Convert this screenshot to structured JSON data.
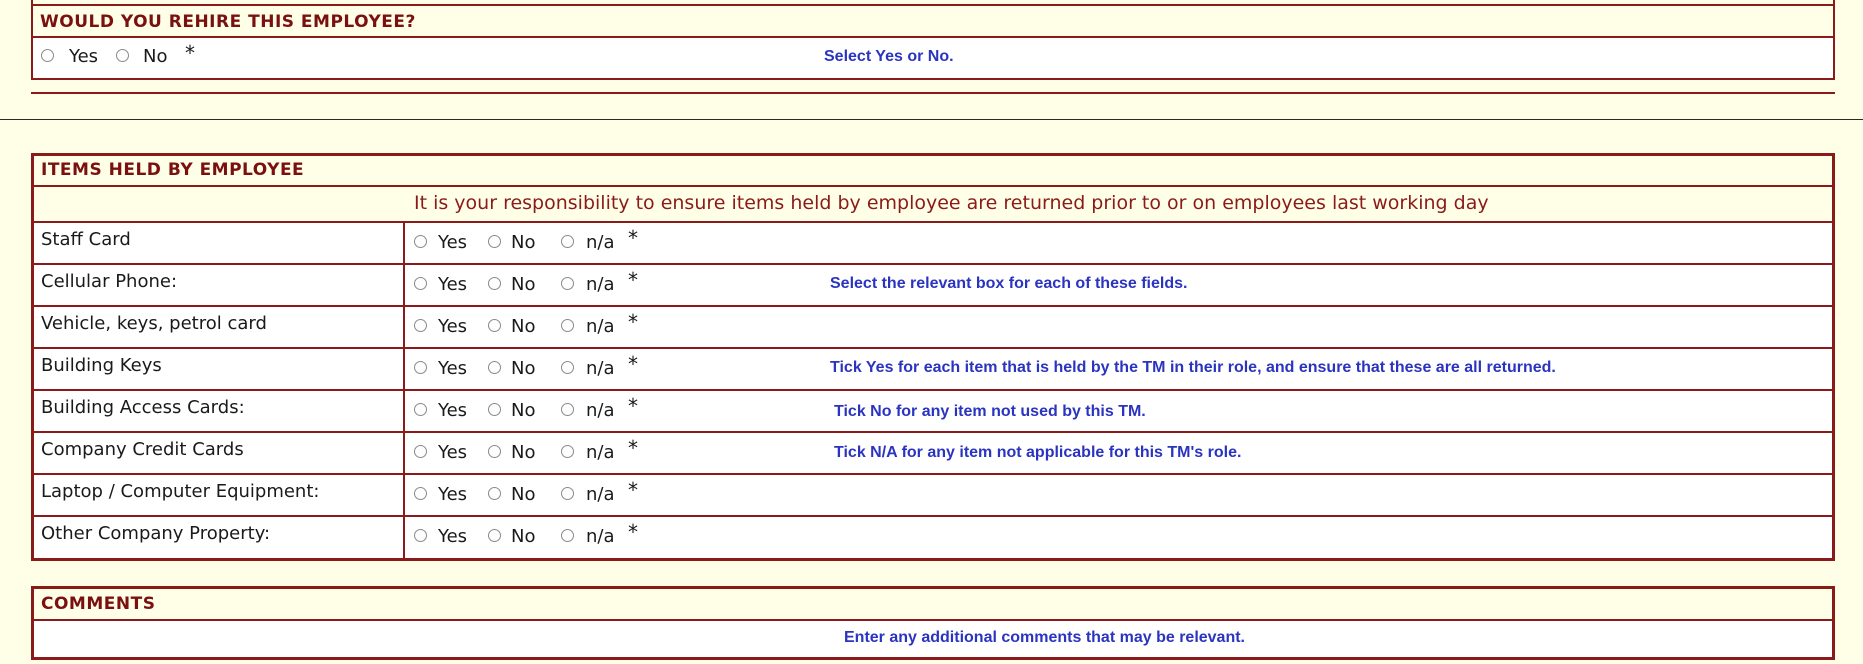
{
  "rehire": {
    "heading": "WOULD YOU REHIRE THIS EMPLOYEE?",
    "options": [
      "Yes",
      "No"
    ],
    "required_mark": "*",
    "hint": "Select Yes or No."
  },
  "items": {
    "heading": "ITEMS HELD BY EMPLOYEE",
    "notice": "It is your responsibility to ensure items held by employee are returned prior to or on employees last working day",
    "options": [
      "Yes",
      "No",
      "n/a"
    ],
    "required_mark": "*",
    "rows": [
      {
        "label": "Staff Card",
        "hint": ""
      },
      {
        "label": "Cellular Phone:",
        "hint": "Select the relevant box for each of these fields."
      },
      {
        "label": "Vehicle, keys, petrol card",
        "hint": ""
      },
      {
        "label": "Building Keys",
        "hint": "Tick Yes for each item that is held by the TM in their role, and ensure that these are all returned."
      },
      {
        "label": "Building Access Cards:",
        "hint": "Tick No for any item not used by this TM."
      },
      {
        "label": "Company Credit Cards",
        "hint": "Tick N/A for any item not applicable for this TM's role."
      },
      {
        "label": "Laptop / Computer Equipment:",
        "hint": ""
      },
      {
        "label": "Other Company Property:",
        "hint": ""
      }
    ]
  },
  "comments": {
    "heading": "COMMENTS",
    "hint": "Enter any additional comments that may be relevant."
  },
  "colors": {
    "background": "#ffffe7",
    "border": "#8b1a1a",
    "heading_text": "#7a1010",
    "hint_text": "#2a34c0"
  }
}
